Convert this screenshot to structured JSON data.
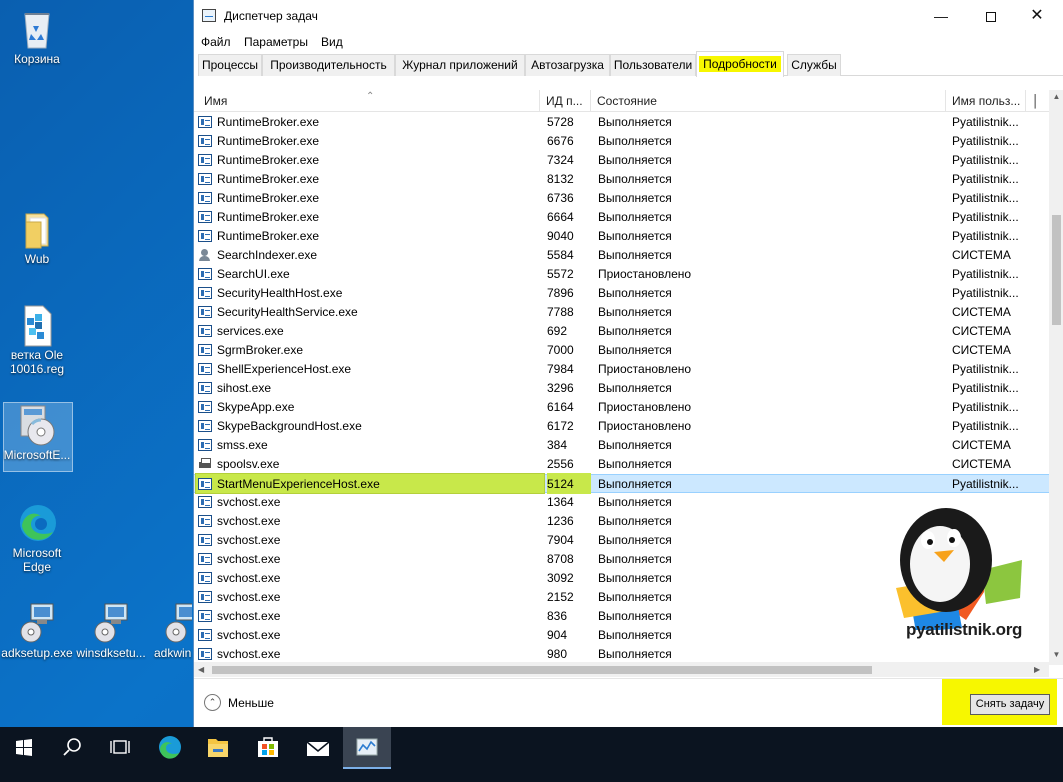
{
  "desktop": {
    "icons": [
      {
        "label": "Корзина"
      },
      {
        "label": "Wub"
      },
      {
        "label": "ветка Ole 10016.reg"
      },
      {
        "label": "MicrosoftE..."
      },
      {
        "label": "Microsoft Edge"
      },
      {
        "label": "adksetup.exe"
      },
      {
        "label": "winsdksetu..."
      },
      {
        "label": "adkwin"
      }
    ]
  },
  "window": {
    "title": "Диспетчер задач",
    "menu": [
      "Файл",
      "Параметры",
      "Вид"
    ],
    "tabs": [
      "Процессы",
      "Производительность",
      "Журнал приложений",
      "Автозагрузка",
      "Пользователи",
      "Подробности",
      "Службы"
    ],
    "active_tab": "Подробности",
    "columns": {
      "name": "Имя",
      "pid": "ИД п...",
      "state": "Состояние",
      "user": "Имя польз..."
    },
    "rows": [
      {
        "name": "RuntimeBroker.exe",
        "pid": "5728",
        "state": "Выполняется",
        "user": "Pyatilistnik...",
        "icon": "process-icon"
      },
      {
        "name": "RuntimeBroker.exe",
        "pid": "6676",
        "state": "Выполняется",
        "user": "Pyatilistnik...",
        "icon": "process-icon"
      },
      {
        "name": "RuntimeBroker.exe",
        "pid": "7324",
        "state": "Выполняется",
        "user": "Pyatilistnik...",
        "icon": "process-icon"
      },
      {
        "name": "RuntimeBroker.exe",
        "pid": "8132",
        "state": "Выполняется",
        "user": "Pyatilistnik...",
        "icon": "process-icon"
      },
      {
        "name": "RuntimeBroker.exe",
        "pid": "6736",
        "state": "Выполняется",
        "user": "Pyatilistnik...",
        "icon": "process-icon"
      },
      {
        "name": "RuntimeBroker.exe",
        "pid": "6664",
        "state": "Выполняется",
        "user": "Pyatilistnik...",
        "icon": "process-icon"
      },
      {
        "name": "RuntimeBroker.exe",
        "pid": "9040",
        "state": "Выполняется",
        "user": "Pyatilistnik...",
        "icon": "process-icon"
      },
      {
        "name": "SearchIndexer.exe",
        "pid": "5584",
        "state": "Выполняется",
        "user": "СИСТЕМА",
        "icon": "user-icon"
      },
      {
        "name": "SearchUI.exe",
        "pid": "5572",
        "state": "Приостановлено",
        "user": "Pyatilistnik...",
        "icon": "process-icon"
      },
      {
        "name": "SecurityHealthHost.exe",
        "pid": "7896",
        "state": "Выполняется",
        "user": "Pyatilistnik...",
        "icon": "process-icon"
      },
      {
        "name": "SecurityHealthService.exe",
        "pid": "7788",
        "state": "Выполняется",
        "user": "СИСТЕМА",
        "icon": "process-icon"
      },
      {
        "name": "services.exe",
        "pid": "692",
        "state": "Выполняется",
        "user": "СИСТЕМА",
        "icon": "process-icon"
      },
      {
        "name": "SgrmBroker.exe",
        "pid": "7000",
        "state": "Выполняется",
        "user": "СИСТЕМА",
        "icon": "process-icon"
      },
      {
        "name": "ShellExperienceHost.exe",
        "pid": "7984",
        "state": "Приостановлено",
        "user": "Pyatilistnik...",
        "icon": "process-icon"
      },
      {
        "name": "sihost.exe",
        "pid": "3296",
        "state": "Выполняется",
        "user": "Pyatilistnik...",
        "icon": "process-icon"
      },
      {
        "name": "SkypeApp.exe",
        "pid": "6164",
        "state": "Приостановлено",
        "user": "Pyatilistnik...",
        "icon": "process-icon"
      },
      {
        "name": "SkypeBackgroundHost.exe",
        "pid": "6172",
        "state": "Приостановлено",
        "user": "Pyatilistnik...",
        "icon": "process-icon"
      },
      {
        "name": "smss.exe",
        "pid": "384",
        "state": "Выполняется",
        "user": "СИСТЕМА",
        "icon": "process-icon"
      },
      {
        "name": "spoolsv.exe",
        "pid": "2556",
        "state": "Выполняется",
        "user": "СИСТЕМА",
        "icon": "printer-icon"
      },
      {
        "name": "StartMenuExperienceHost.exe",
        "pid": "5124",
        "state": "Выполняется",
        "user": "Pyatilistnik...",
        "icon": "process-icon",
        "selected": true
      },
      {
        "name": "svchost.exe",
        "pid": "1364",
        "state": "Выполняется",
        "user": "",
        "icon": "process-icon"
      },
      {
        "name": "svchost.exe",
        "pid": "1236",
        "state": "Выполняется",
        "user": "",
        "icon": "process-icon"
      },
      {
        "name": "svchost.exe",
        "pid": "7904",
        "state": "Выполняется",
        "user": "",
        "icon": "process-icon"
      },
      {
        "name": "svchost.exe",
        "pid": "8708",
        "state": "Выполняется",
        "user": "",
        "icon": "process-icon"
      },
      {
        "name": "svchost.exe",
        "pid": "3092",
        "state": "Выполняется",
        "user": "",
        "icon": "process-icon"
      },
      {
        "name": "svchost.exe",
        "pid": "2152",
        "state": "Выполняется",
        "user": "",
        "icon": "process-icon"
      },
      {
        "name": "svchost.exe",
        "pid": "836",
        "state": "Выполняется",
        "user": "",
        "icon": "process-icon"
      },
      {
        "name": "svchost.exe",
        "pid": "904",
        "state": "Выполняется",
        "user": "",
        "icon": "process-icon"
      },
      {
        "name": "svchost.exe",
        "pid": "980",
        "state": "Выполняется",
        "user": "",
        "icon": "process-icon"
      }
    ],
    "footer": {
      "less_label": "Меньше",
      "end_task_label": "Снять задачу"
    }
  },
  "watermark": {
    "text": "pyatilistnik.org"
  },
  "colors": {
    "highlight_yellow": "#f7f700",
    "selected_row": "#cce8ff",
    "name_highlight": "#c8e84a",
    "desktop_blue": "#0b6bc0",
    "taskbar": "#0b1420"
  }
}
